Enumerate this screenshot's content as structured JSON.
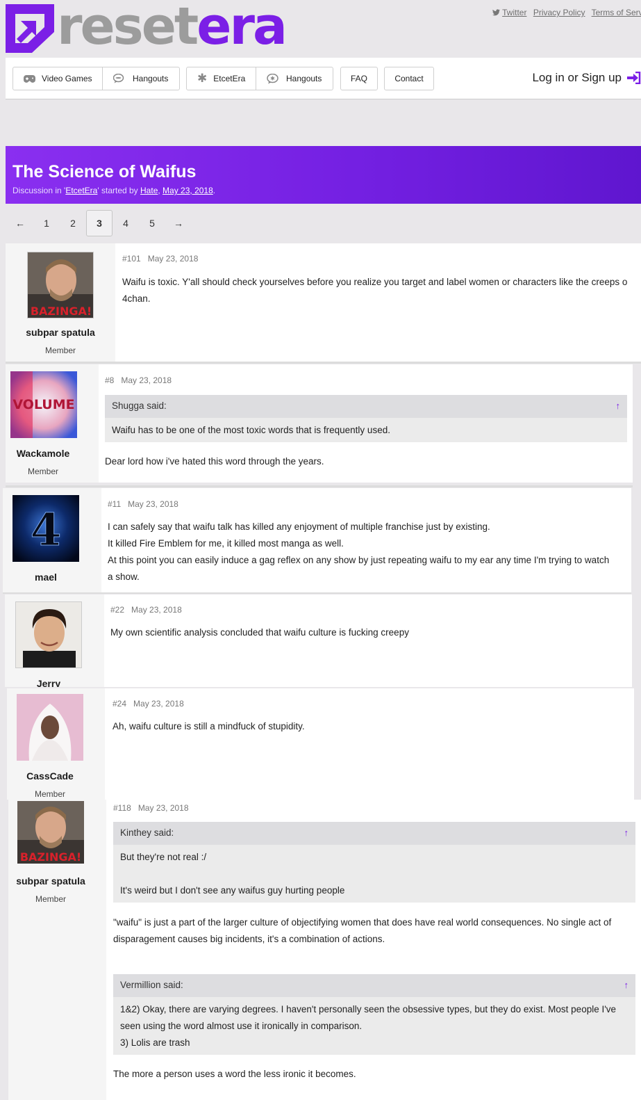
{
  "site": {
    "logo_alt": "resetera",
    "logo_part1": "reset",
    "logo_part2": "era",
    "brand_color": "#7b1fe6"
  },
  "toplinks": [
    "Twitter",
    "Privacy Policy",
    "Terms of Service"
  ],
  "nav": {
    "group1": [
      {
        "label": "Video Games",
        "icon": "gamepad-icon"
      },
      {
        "label": "Hangouts",
        "icon": "chat-bubbles-icon"
      }
    ],
    "group2": [
      {
        "label": "EtcetEra",
        "icon": "asterisk-icon"
      },
      {
        "label": "Hangouts",
        "icon": "chat-bubbles-icon"
      }
    ],
    "faq": "FAQ",
    "contact": "Contact",
    "login": "Log in or Sign up"
  },
  "thread": {
    "title": "The Science of Waifus",
    "meta_prefix": "Discussion in '",
    "forum": "EtcetEra",
    "meta_mid": "' started by ",
    "author": "Hate",
    "meta_sep": ", ",
    "date": "May 23, 2018",
    "meta_end": "."
  },
  "pagination": {
    "prev": "←",
    "pages": [
      "1",
      "2",
      "3",
      "4",
      "5"
    ],
    "current": "3",
    "next": "→"
  },
  "posts": [
    {
      "user": "subpar spatula",
      "title": "Member",
      "avatar_caption": "BAZINGA!",
      "num": "#101",
      "date": "May 23, 2018",
      "lines": [
        "Waifu is toxic. Y'all should check yourselves before you realize you target and label women or characters like the creeps o",
        "4chan."
      ]
    },
    {
      "user": "Wackamole",
      "title": "Member",
      "avatar_caption": "VOLUME",
      "num": "#8",
      "date": "May 23, 2018",
      "quote_author": "Shugga said:",
      "quote_text": "Waifu has to be one of the most toxic words that is frequently used.",
      "lines": [
        "Dear lord how i've hated this word through the years."
      ]
    },
    {
      "user": "mael",
      "title": "",
      "avatar_caption": "4",
      "num": "#11",
      "date": "May 23, 2018",
      "lines": [
        "I can safely say that waifu talk has killed any enjoyment of multiple franchise just by existing.",
        "It killed Fire Emblem for me, it killed most manga as well.",
        "At this point you can easily induce a gag reflex on any show by just repeating waifu to my ear any time I'm trying to watch",
        "a show."
      ]
    },
    {
      "user": "Jerry",
      "title": "",
      "num": "#22",
      "date": "May 23, 2018",
      "lines": [
        "My own scientific analysis concluded that waifu culture is fucking creepy"
      ]
    },
    {
      "user": "CassCade",
      "title": "Member",
      "num": "#24",
      "date": "May 23, 2018",
      "lines": [
        "Ah, waifu culture is still a mindfuck of stupidity."
      ]
    },
    {
      "user": "subpar spatula",
      "title": "Member",
      "avatar_caption": "BAZINGA!",
      "num": "#118",
      "date": "May 23, 2018",
      "quote1_author": "Kinthey said:",
      "quote1_lines": [
        "But they're not real :/",
        "",
        "It's weird but I don't see any waifus guy hurting people"
      ],
      "para1": [
        "\"waifu\" is just a part of the larger culture of objectifying women that does have real world consequences. No single act of",
        "disparagement causes big incidents, it's a combination of actions."
      ],
      "quote2_author": "Vermillion said:",
      "quote2_lines": [
        "1&2) Okay, there are varying degrees. I haven't personally seen the obsessive types, but they do exist. Most people I've",
        "seen using the word almost use it ironically in comparison.",
        "3) Lolis are trash"
      ],
      "para2": [
        "The more a person uses a word the less ironic it becomes."
      ]
    }
  ],
  "quote_jump": "↑"
}
